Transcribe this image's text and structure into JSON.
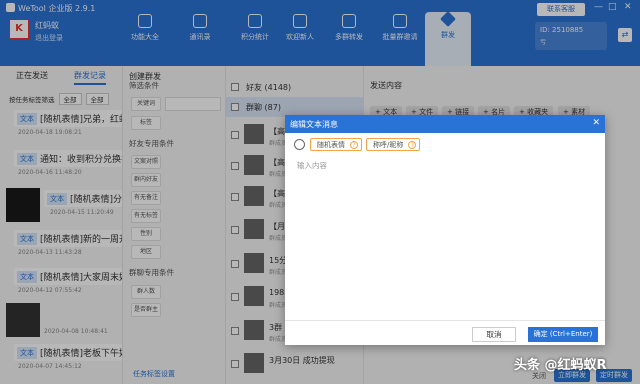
{
  "app": {
    "title": "WeTool 企业版 2.9.1",
    "contact_button": "联系客服",
    "win_min": "—",
    "win_max": "□",
    "win_close": "✕"
  },
  "user": {
    "avatar_letter": "K",
    "name": "红蚂蚁",
    "logout": "退出登录",
    "id_label": "ID: 2510885",
    "id_sub": "亏",
    "id_button": "⇄"
  },
  "nav": [
    {
      "label": "功能大全"
    },
    {
      "label": "通讯录"
    },
    {
      "label": "积分统计"
    },
    {
      "label": "欢迎新人"
    },
    {
      "label": "多群转发"
    },
    {
      "label": "批量群邀请"
    },
    {
      "label": "群发"
    }
  ],
  "left": {
    "tabs": [
      "正在发送",
      "群发记录"
    ],
    "filters": {
      "label1": "按任务标签筛选",
      "sel1": "全部",
      "sel2": "全部"
    },
    "messages": [
      {
        "tag": "文本",
        "text": "[随机表情]兄弟，红蚂蚁",
        "time": "2020-04-18 19:08:21"
      },
      {
        "tag": "文本",
        "text": "通知：收到积分兑换礼品",
        "time": "2020-04-16 11:48:20"
      },
      {
        "tag": "文本",
        "text": "[随机表情]分享",
        "time": "2020-04-15 11:20:49"
      },
      {
        "tag": "文本",
        "text": "[随机表情]新的一周开",
        "time": "2020-04-13 11:43:28"
      },
      {
        "tag": "文本",
        "text": "[随机表情]大家周末好",
        "time": "2020-04-12 07:55:42"
      },
      {
        "tag": "",
        "text": "",
        "time": "2020-04-08 10:48:41"
      },
      {
        "tag": "文本",
        "text": "[随机表情]老板下午好",
        "time": "2020-04-07 14:45:12"
      }
    ]
  },
  "mid": {
    "title": "创建群发",
    "filter_section": "筛选条件",
    "keyword": "关键词",
    "label": "标签",
    "friend_section": "好友专用条件",
    "btn_sex": "文案对照",
    "btn_group_friend": "群内好友",
    "btn_remark": "有无备注",
    "btn_has": "有无标签",
    "btn_gender": "性别",
    "btn_region": "地区",
    "group_section": "群聊专用条件",
    "btn_count": "群人数",
    "btn_owner": "是否群主",
    "footer": "任务标签设置"
  },
  "list": {
    "friends_header": "好友 (4148)",
    "groups_header": "群聊 (87)",
    "items": [
      {
        "name": "【高",
        "sub": "群成员"
      },
      {
        "name": "【高",
        "sub": "群成员"
      },
      {
        "name": "【高",
        "sub": "群成员"
      },
      {
        "name": "【月",
        "sub": "群成员"
      },
      {
        "name": "15分",
        "sub": "群成员"
      },
      {
        "name": "1983",
        "sub": "群成员"
      },
      {
        "name": "3群",
        "sub": "群成员"
      },
      {
        "name": "3月30日 成功提现",
        "sub": ""
      }
    ]
  },
  "send": {
    "title": "发送内容",
    "buttons": [
      "+ 文本",
      "+ 文件",
      "+ 链接",
      "+ 名片",
      "+ 收藏夹",
      "+ 素材"
    ],
    "footer_close": "关闭",
    "footer_send": "立即群发",
    "footer_schedule": "定时群发"
  },
  "dialog": {
    "title": "编辑文本消息",
    "close": "✕",
    "chip1": "随机表情",
    "chip2": "称呼/昵称",
    "chip_q": "?",
    "placeholder": "输入内容",
    "cancel": "取消",
    "confirm": "确定 (Ctrl+Enter)"
  },
  "watermark": "头条 @红蚂蚁R"
}
